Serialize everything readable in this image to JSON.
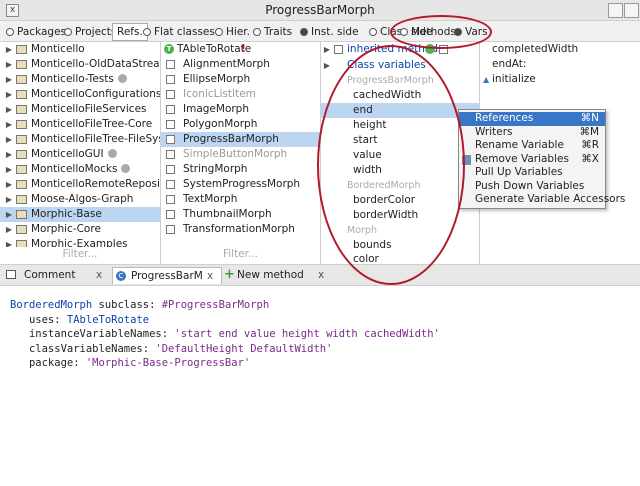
{
  "window": {
    "title": "ProgressBarMorph",
    "close": "x"
  },
  "toolbar": {
    "items": [
      {
        "label": "Packages",
        "selected": false
      },
      {
        "label": "Projects",
        "selected": false
      },
      {
        "label": "Refs.",
        "selected": false
      },
      {
        "label": "Flat classes",
        "selected": false
      },
      {
        "label": "Hier.",
        "selected": false
      },
      {
        "label": "Traits",
        "selected": false
      },
      {
        "label": "Inst. side",
        "selected": true
      },
      {
        "label": "Class side",
        "selected": false
      },
      {
        "label": "Methods",
        "selected": false
      },
      {
        "label": "Vars",
        "selected": true
      }
    ]
  },
  "packages": {
    "items": [
      "Monticello",
      "Monticello-OldDataStreamCo",
      "Monticello-Tests",
      "MonticelloConfigurations",
      "MonticelloFileServices",
      "MonticelloFileTree-Core",
      "MonticelloFileTree-FileSystem",
      "MonticelloGUI",
      "MonticelloMocks",
      "MonticelloRemoteRepositorie",
      "Moose-Algos-Graph",
      "Morphic-Base",
      "Morphic-Core",
      "Morphic-Examples"
    ],
    "filter": "Filter..."
  },
  "classes": {
    "items": [
      "TAbleToRotate",
      "AlignmentMorph",
      "EllipseMorph",
      "IconicListItem",
      "ImageMorph",
      "PolygonMorph",
      "ProgressBarMorph",
      "SimpleButtonMorph",
      "StringMorph",
      "SystemProgressMorph",
      "TextMorph",
      "ThumbnailMorph",
      "TransformationMorph"
    ],
    "trait_badge": "T",
    "warning": "!",
    "filter": "Filter..."
  },
  "vars": {
    "inherited": "inherited methods",
    "class_vars": "Class variables",
    "cat1": "ProgressBarMorph",
    "v1": [
      "cachedWidth",
      "end",
      "height",
      "start",
      "value",
      "width"
    ],
    "cat2": "BorderedMorph",
    "v2": [
      "borderColor",
      "borderWidth"
    ],
    "cat3": "Morph",
    "v3": [
      "bounds",
      "color"
    ]
  },
  "methods": {
    "items": [
      "completedWidth",
      "endAt:",
      "initialize"
    ]
  },
  "context_menu": {
    "items": [
      {
        "label": "References",
        "shortcut": "⌘N"
      },
      {
        "label": "Writers",
        "shortcut": "⌘M"
      },
      {
        "label": "Rename Variable",
        "shortcut": "⌘R"
      },
      {
        "label": "Remove Variables",
        "shortcut": "⌘X"
      },
      {
        "label": "Pull Up Variables",
        "shortcut": ""
      },
      {
        "label": "Push Down Variables",
        "shortcut": ""
      },
      {
        "label": "Generate Variable Accessors",
        "shortcut": ""
      }
    ]
  },
  "tabs": [
    {
      "label": "Comment",
      "close": "x"
    },
    {
      "label": "ProgressBarMorph",
      "close": "x"
    },
    {
      "label": "New method",
      "close": "x"
    }
  ],
  "code": {
    "l1a": "BorderedMorph",
    "l1b": " subclass: ",
    "l1c": "#ProgressBarMorph",
    "l2a": "   uses: ",
    "l2b": "TAbleToRotate",
    "l3a": "   instanceVariableNames: ",
    "l3b": "'start end value height width cachedWidth'",
    "l4a": "   classVariableNames: ",
    "l4b": "'DefaultHeight DefaultWidth'",
    "l5a": "   package: ",
    "l5b": "'Morphic-Base-ProgressBar'"
  },
  "colors": {
    "selection": "#bcd6f2",
    "menu_highlight": "#3a76c7",
    "annotation": "#b3182b"
  }
}
